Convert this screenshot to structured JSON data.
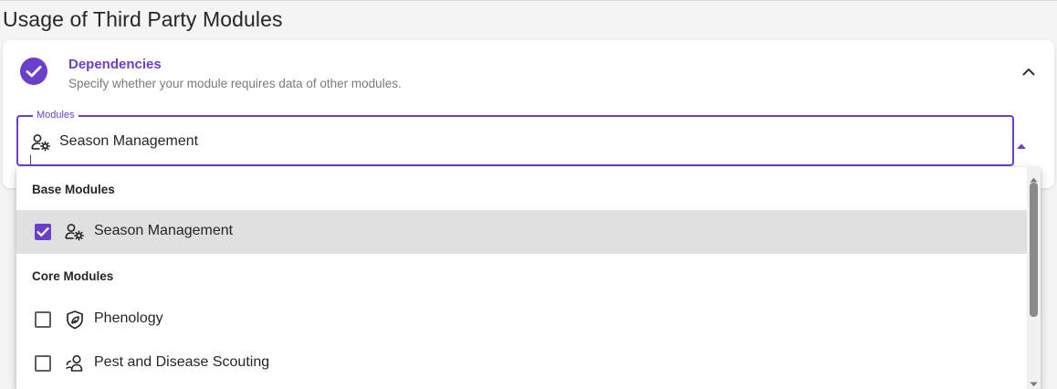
{
  "page": {
    "title": "Usage of Third Party Modules"
  },
  "section": {
    "title": "Dependencies",
    "subtitle": "Specify whether your module requires data of other modules.",
    "status": "completed",
    "expanded": true
  },
  "modules_field": {
    "label": "Modules",
    "value": "Season Management",
    "value_icon": "user-gear-icon"
  },
  "dropdown": {
    "groups": [
      {
        "header": "Base Modules",
        "options": [
          {
            "label": "Season Management",
            "icon": "user-gear-icon",
            "checked": true
          }
        ]
      },
      {
        "header": "Core Modules",
        "options": [
          {
            "label": "Phenology",
            "icon": "leaf-shield-icon",
            "checked": false
          },
          {
            "label": "Pest and Disease Scouting",
            "icon": "bug-scout-icon",
            "checked": false
          }
        ]
      }
    ]
  },
  "colors": {
    "accent": "#6a3fc9",
    "selected_row": "#e0e0e0",
    "background": "#f4f4f4"
  }
}
